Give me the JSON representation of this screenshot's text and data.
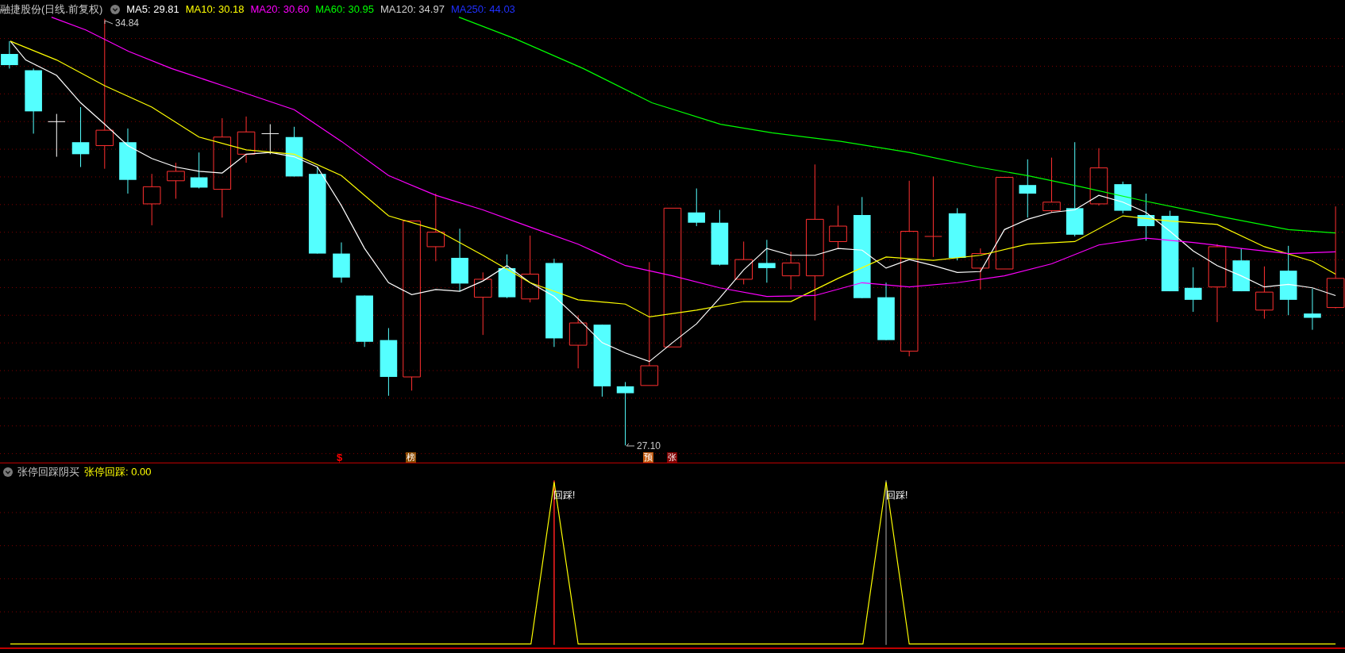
{
  "header": {
    "title": "融捷股份(日线.前复权)",
    "averages": [
      {
        "label": "MA5: 29.81",
        "color": "#ffffff"
      },
      {
        "label": "MA10: 30.18",
        "color": "#ffff00"
      },
      {
        "label": "MA20: 30.60",
        "color": "#ff00ff"
      },
      {
        "label": "MA60: 30.95",
        "color": "#00ff00"
      },
      {
        "label": "MA120: 34.97",
        "color": "#d0d0d0"
      },
      {
        "label": "MA250: 44.03",
        "color": "#2030ff"
      }
    ]
  },
  "price_chart": {
    "high_label": "34.84",
    "low_label": "27.10",
    "markers": [
      {
        "text": "$",
        "kind": "plain",
        "color": "#ff0000"
      },
      {
        "text": "榜",
        "kind": "badge",
        "color": "#8b4a00"
      },
      {
        "text": "预",
        "kind": "badge",
        "color": "#c05a10"
      },
      {
        "text": "张",
        "kind": "badge",
        "color": "#800000"
      }
    ]
  },
  "indicator": {
    "name": "张停回踩阴买",
    "value_label": "张停回踩: 0.00",
    "signals": [
      "回踩!",
      "回踩!"
    ]
  }
}
